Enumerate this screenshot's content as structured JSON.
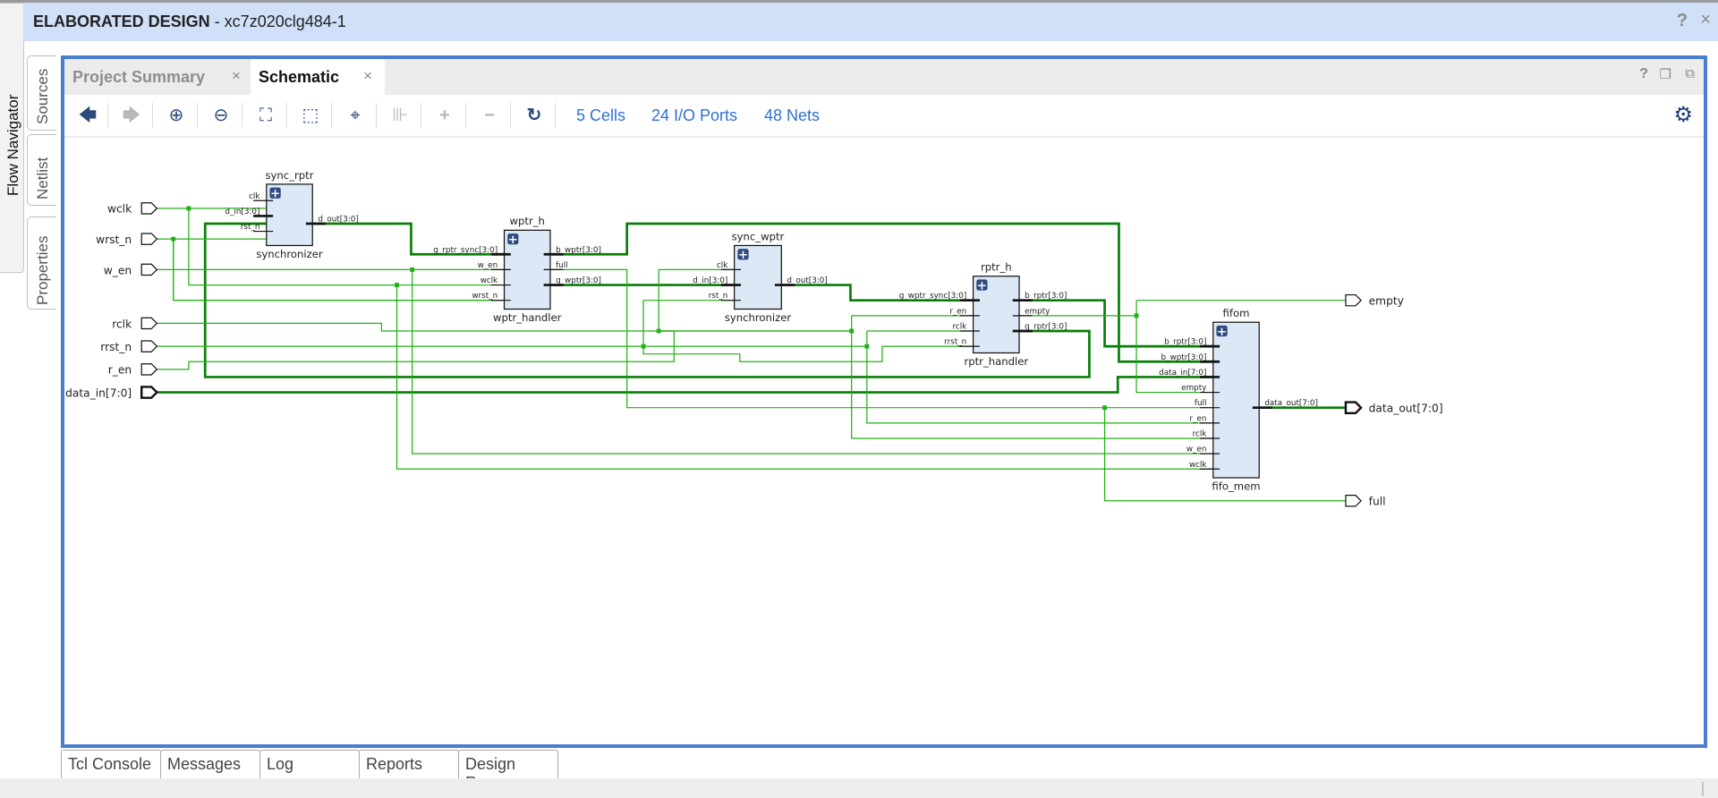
{
  "window": {
    "title_bold": "ELABORATED DESIGN",
    "title_rest": " - xc7z020clg484-1",
    "help_icon": "?",
    "close_icon": "×"
  },
  "left_nav": {
    "flow_navigator": "Flow Navigator",
    "side_tabs": [
      "Sources",
      "Netlist",
      "Properties"
    ]
  },
  "tabs": [
    {
      "label": "Project Summary",
      "active": false,
      "close": "×"
    },
    {
      "label": "Schematic",
      "active": true,
      "close": "×"
    }
  ],
  "panel_controls": {
    "help": "?",
    "restore": "❐",
    "float": "⧉"
  },
  "toolbar": {
    "buttons": [
      {
        "name": "back",
        "icon": "🡄",
        "enabled": true
      },
      {
        "name": "forward",
        "icon": "🡆",
        "enabled": false
      },
      {
        "name": "zoom-in",
        "icon": "⊕",
        "enabled": true
      },
      {
        "name": "zoom-out",
        "icon": "⊖",
        "enabled": true
      },
      {
        "name": "zoom-fit",
        "icon": "⛶",
        "enabled": true
      },
      {
        "name": "zoom-area",
        "icon": "⬚",
        "enabled": true
      },
      {
        "name": "select-target",
        "icon": "⌖",
        "enabled": true
      },
      {
        "name": "cell",
        "icon": "⊪",
        "enabled": false
      },
      {
        "name": "expand",
        "icon": "+",
        "enabled": false
      },
      {
        "name": "collapse",
        "icon": "−",
        "enabled": false
      },
      {
        "name": "reload",
        "icon": "↻",
        "enabled": true
      }
    ],
    "stats": {
      "cells": "5 Cells",
      "io_ports": "24 I/O Ports",
      "nets": "48 Nets"
    },
    "settings_icon": "⚙"
  },
  "schematic": {
    "input_ports": [
      "wclk",
      "wrst_n",
      "w_en",
      "rclk",
      "rrst_n",
      "r_en",
      "data_in[7:0]"
    ],
    "output_ports": [
      "empty",
      "data_out[7:0]",
      "full"
    ],
    "cells": [
      {
        "instance": "sync_rptr",
        "module": "synchronizer",
        "inputs": [
          "clk",
          "d_in[3:0]",
          "rst_n"
        ],
        "outputs": [
          "d_out[3:0]"
        ]
      },
      {
        "instance": "wptr_h",
        "module": "wptr_handler",
        "inputs": [
          "g_rptr_sync[3:0]",
          "w_en",
          "wclk",
          "wrst_n"
        ],
        "outputs": [
          "b_wptr[3:0]",
          "full",
          "g_wptr[3:0]"
        ]
      },
      {
        "instance": "sync_wptr",
        "module": "synchronizer",
        "inputs": [
          "clk",
          "d_in[3:0]",
          "rst_n"
        ],
        "outputs": [
          "d_out[3:0]"
        ]
      },
      {
        "instance": "rptr_h",
        "module": "rptr_handler",
        "inputs": [
          "g_wptr_sync[3:0]",
          "r_en",
          "rclk",
          "rrst_n"
        ],
        "outputs": [
          "b_rptr[3:0]",
          "empty",
          "g_rptr[3:0]"
        ]
      },
      {
        "instance": "fifom",
        "module": "fifo_mem",
        "inputs": [
          "b_rptr[3:0]",
          "b_wptr[3:0]",
          "data_in[7:0]",
          "empty",
          "full",
          "r_en",
          "rclk",
          "w_en",
          "wclk"
        ],
        "outputs": [
          "data_out[7:0]"
        ]
      }
    ],
    "expand_icon": "+",
    "colors": {
      "wire": "#22b014",
      "bus": "#067f06",
      "cell_fill": "#dde8f7",
      "cell_border": "#111111"
    }
  },
  "bottom_tabs": [
    "Tcl Console",
    "Messages",
    "Log",
    "Reports",
    "Design Runs"
  ]
}
